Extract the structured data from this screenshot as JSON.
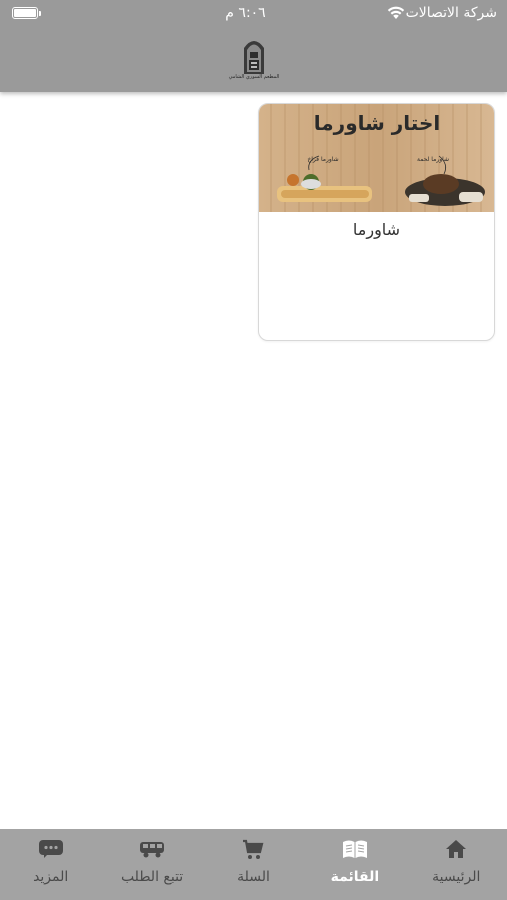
{
  "status_bar": {
    "carrier": "شركة الاتصالات",
    "time": "٦:٠٦ م"
  },
  "header": {
    "logo_icon": "restaurant-logo-icon",
    "logo_caption": "المطعم السوري الشامي",
    "background_color": "#9a9a9a"
  },
  "menu": {
    "items": [
      {
        "title": "شاورما",
        "image_heading": "اختار شاورما",
        "image_label_left": "شاورما فراخ",
        "image_label_right": "شاورما لحمة"
      }
    ]
  },
  "tabbar": {
    "background_color": "#a3a3a3",
    "tabs": [
      {
        "label": "الرئيسية",
        "icon": "home-icon",
        "active": false
      },
      {
        "label": "القائمة",
        "icon": "menu-book-icon",
        "active": true
      },
      {
        "label": "السلة",
        "icon": "cart-icon",
        "active": false
      },
      {
        "label": "تتبع الطلب",
        "icon": "delivery-truck-icon",
        "active": false
      },
      {
        "label": "المزيد",
        "icon": "more-chat-icon",
        "active": false
      }
    ]
  }
}
